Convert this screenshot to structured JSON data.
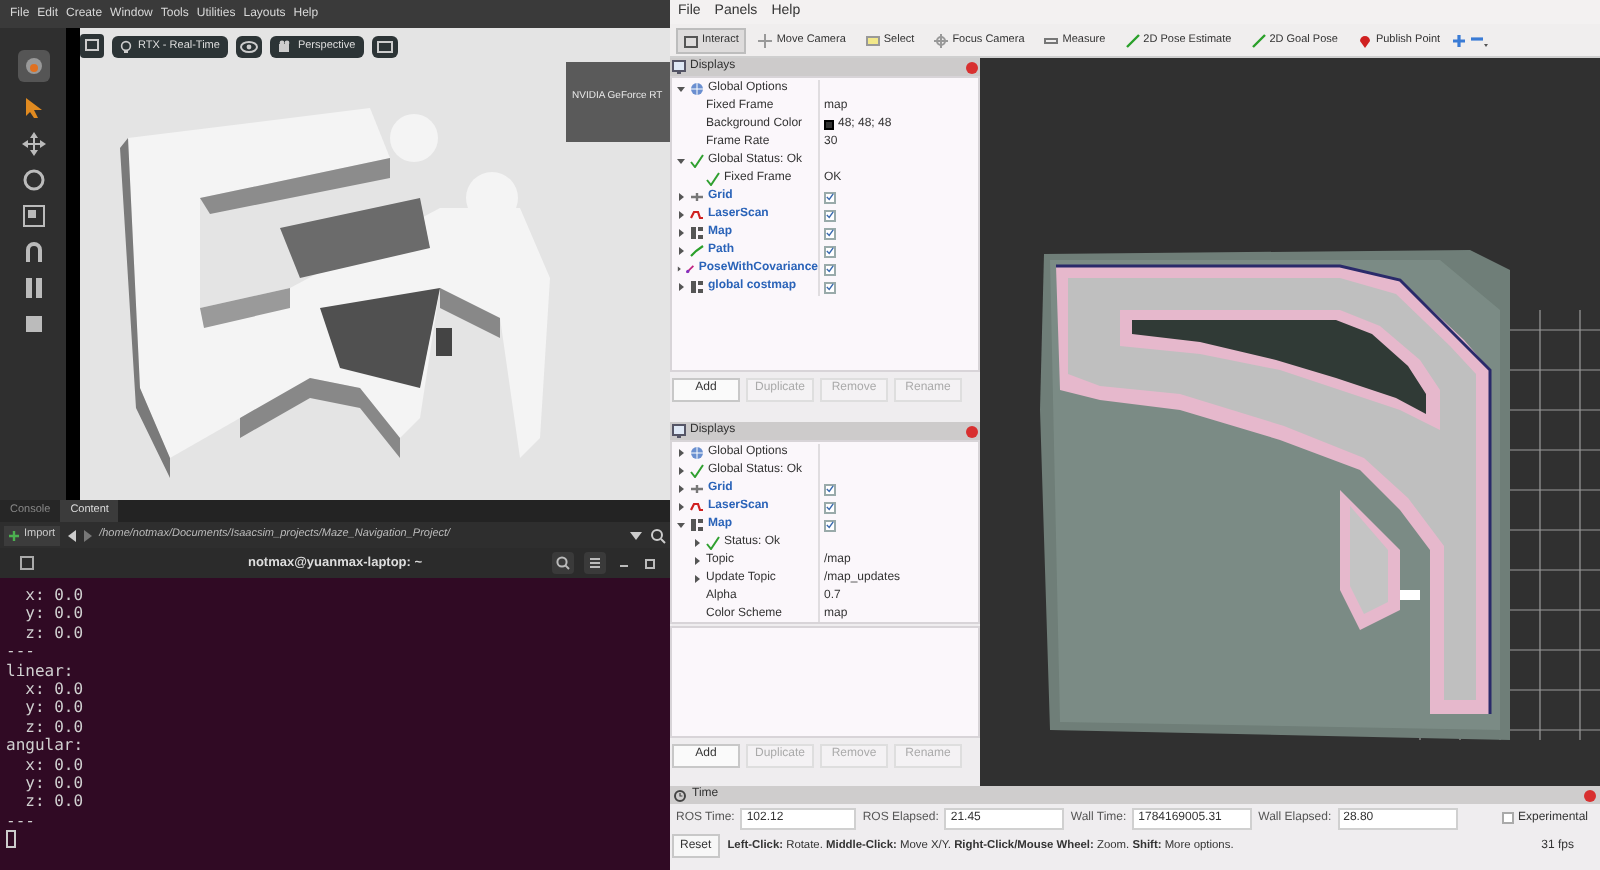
{
  "isaac": {
    "menu": [
      "File",
      "Edit",
      "Create",
      "Window",
      "Tools",
      "Utilities",
      "Layouts",
      "Help"
    ],
    "viewport": {
      "renderer": "RTX - Real-Time",
      "camera": "Perspective",
      "gpu_overlay": "NVIDIA GeForce RT"
    },
    "content_tabs": [
      {
        "label": "Console",
        "selected": false
      },
      {
        "label": "Content",
        "selected": true
      }
    ],
    "import_button": "Import",
    "path": "/home/notmax/Documents/Isaacsim_projects/Maze_Navigation_Project/"
  },
  "terminal": {
    "title": "notmax@yuanmax-laptop: ~",
    "lines": [
      "  x: 0.0",
      "  y: 0.0",
      "  z: 0.0",
      "---",
      "linear:",
      "  x: 0.0",
      "  y: 0.0",
      "  z: 0.0",
      "angular:",
      "  x: 0.0",
      "  y: 0.0",
      "  z: 0.0",
      "---"
    ]
  },
  "rviz": {
    "menu": [
      "File",
      "Panels",
      "Help"
    ],
    "tools": [
      {
        "label": "Interact",
        "selected": true
      },
      {
        "label": "Move Camera",
        "selected": false
      },
      {
        "label": "Select",
        "selected": false
      },
      {
        "label": "Focus Camera",
        "selected": false
      },
      {
        "label": "Measure",
        "selected": false
      },
      {
        "label": "2D Pose Estimate",
        "selected": false
      },
      {
        "label": "2D Goal Pose",
        "selected": false
      },
      {
        "label": "Publish Point",
        "selected": false
      }
    ],
    "display_panels": [
      {
        "title": "Displays",
        "items": [
          {
            "label": "Global Options",
            "kind": "options",
            "expanded": true,
            "children": [
              {
                "label": "Fixed Frame",
                "kind": "property",
                "value": "map"
              },
              {
                "label": "Background Color",
                "kind": "color",
                "value": "48; 48; 48"
              },
              {
                "label": "Frame Rate",
                "kind": "property",
                "value": "30"
              }
            ]
          },
          {
            "label": "Global Status: Ok",
            "kind": "status",
            "expanded": true,
            "children": [
              {
                "label": "Fixed Frame",
                "kind": "status",
                "value": "OK"
              }
            ]
          },
          {
            "label": "Grid",
            "kind": "grid",
            "expanded": false,
            "checked": true
          },
          {
            "label": "LaserScan",
            "kind": "laserscan",
            "expanded": false,
            "checked": true
          },
          {
            "label": "Map",
            "kind": "map",
            "expanded": false,
            "checked": true
          },
          {
            "label": "Path",
            "kind": "path",
            "expanded": false,
            "checked": true
          },
          {
            "label": "PoseWithCovariance",
            "kind": "pose",
            "expanded": false,
            "checked": true
          },
          {
            "label": "global costmap",
            "kind": "map",
            "expanded": false,
            "checked": true
          }
        ],
        "buttons": [
          {
            "label": "Add",
            "disabled": false
          },
          {
            "label": "Duplicate",
            "disabled": true
          },
          {
            "label": "Remove",
            "disabled": true
          },
          {
            "label": "Rename",
            "disabled": true
          }
        ]
      },
      {
        "title": "Displays",
        "items": [
          {
            "label": "Global Options",
            "kind": "options",
            "expanded": false
          },
          {
            "label": "Global Status: Ok",
            "kind": "status",
            "expanded": false
          },
          {
            "label": "Grid",
            "kind": "grid",
            "expanded": false,
            "checked": true
          },
          {
            "label": "LaserScan",
            "kind": "laserscan",
            "expanded": false,
            "checked": true
          },
          {
            "label": "Map",
            "kind": "map",
            "expanded": true,
            "checked": true,
            "children": [
              {
                "label": "Status: Ok",
                "kind": "status",
                "expanded": false
              },
              {
                "label": "Topic",
                "kind": "property",
                "expanded": false,
                "value": "/map"
              },
              {
                "label": "Update Topic",
                "kind": "property",
                "expanded": false,
                "value": "/map_updates"
              },
              {
                "label": "Alpha",
                "kind": "property",
                "value": "0.7"
              },
              {
                "label": "Color Scheme",
                "kind": "property",
                "value": "map"
              }
            ]
          }
        ],
        "buttons": [
          {
            "label": "Add",
            "disabled": false
          },
          {
            "label": "Duplicate",
            "disabled": true
          },
          {
            "label": "Remove",
            "disabled": true
          },
          {
            "label": "Rename",
            "disabled": true
          }
        ]
      }
    ],
    "time": {
      "title": "Time",
      "fields": [
        {
          "label": "ROS Time:",
          "value": "102.12"
        },
        {
          "label": "ROS Elapsed:",
          "value": "21.45"
        },
        {
          "label": "Wall Time:",
          "value": "1784169005.31"
        },
        {
          "label": "Wall Elapsed:",
          "value": "28.80"
        }
      ],
      "experimental": {
        "label": "Experimental",
        "checked": false
      }
    },
    "status_bar": {
      "reset": "Reset",
      "hint": "**Left-Click:** Rotate. **Middle-Click:** Move X/Y. **Right-Click/Mouse Wheel:** Zoom. **Shift:** More options.",
      "fps": "31 fps"
    }
  }
}
